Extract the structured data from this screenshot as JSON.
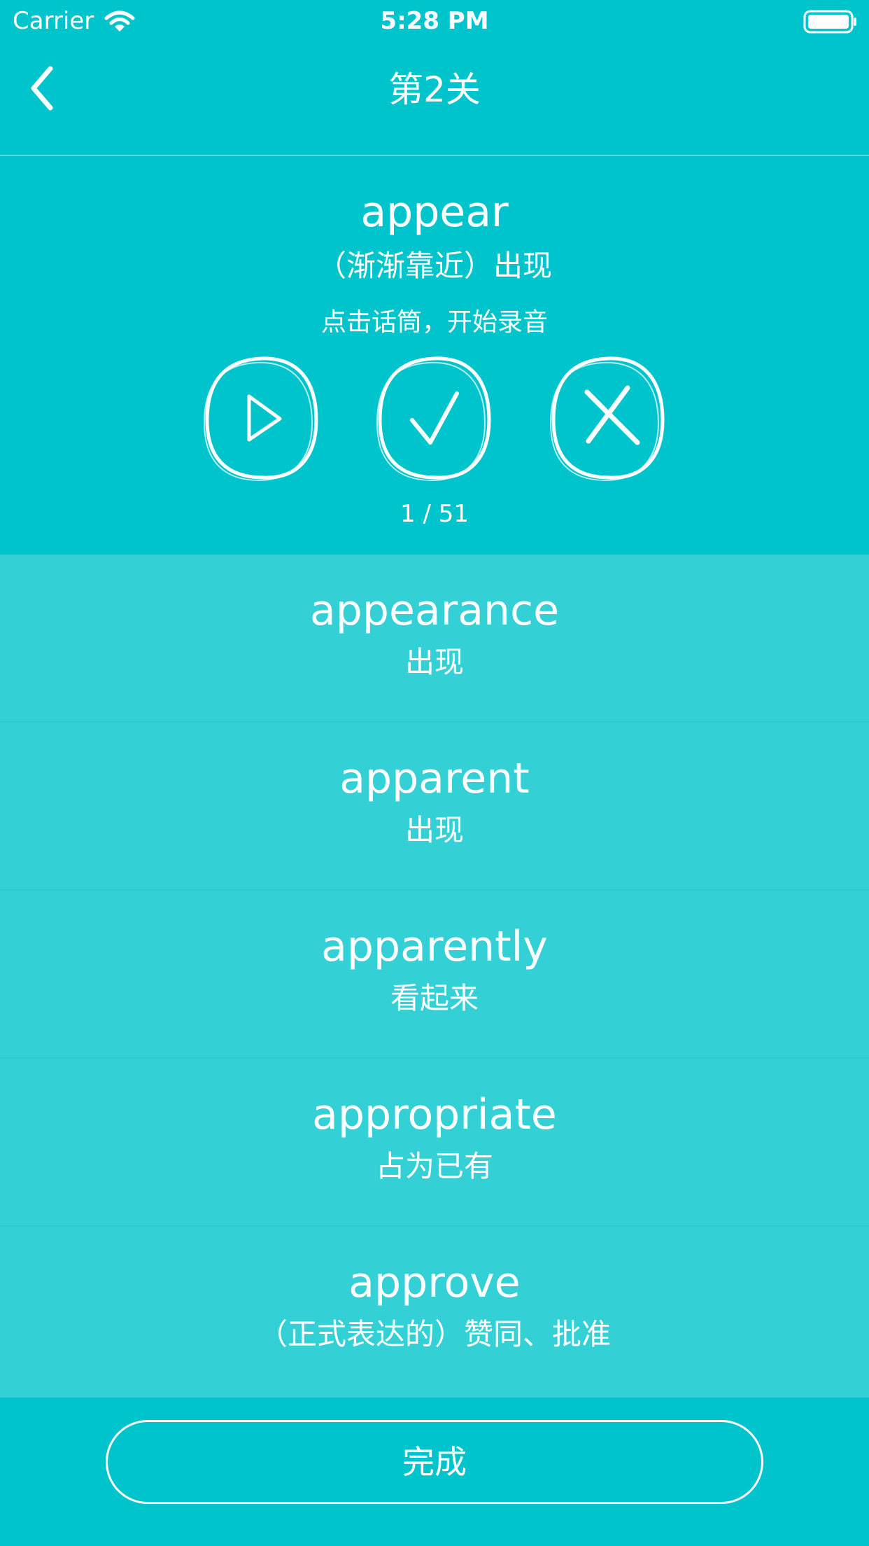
{
  "status_bar": {
    "carrier": "Carrier",
    "time": "5:28 PM",
    "icons": [
      "wifi-icon",
      "battery-icon"
    ]
  },
  "nav": {
    "title": "第2关",
    "back_icon": "chevron-left-icon"
  },
  "current": {
    "word": "appear",
    "meaning": "（渐渐靠近）出现",
    "hint": "点击话筒，开始录音",
    "actions": [
      "play-icon",
      "check-icon",
      "cross-icon"
    ],
    "progress": "1 / 51"
  },
  "word_list": [
    {
      "word": "appearance",
      "meaning": "出现"
    },
    {
      "word": "apparent",
      "meaning": "出现"
    },
    {
      "word": "apparently",
      "meaning": "看起来"
    },
    {
      "word": "appropriate",
      "meaning": "占为已有"
    },
    {
      "word": "approve",
      "meaning": "（正式表达的）赞同、批准"
    }
  ],
  "done_button": {
    "label": "完成"
  },
  "colors": {
    "background": "#00C4CC",
    "list_background": "#33D0D6",
    "foreground": "#FFFFFF"
  }
}
